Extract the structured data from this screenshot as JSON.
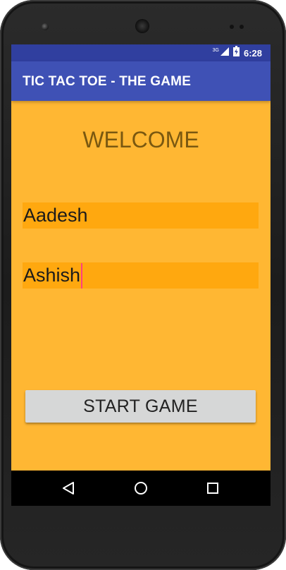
{
  "status_bar": {
    "network_label": "3G",
    "time": "6:28"
  },
  "app_bar": {
    "title": "TIC TAC TOE - THE GAME"
  },
  "main": {
    "welcome": "WELCOME",
    "player1_name": "Aadesh",
    "player2_name": "Ashish",
    "start_button_label": "START GAME"
  },
  "nav_bar": {
    "icons": [
      "back-icon",
      "home-icon",
      "recents-icon"
    ]
  },
  "colors": {
    "status_bar": "#303f9f",
    "app_bar": "#3f51b5",
    "background": "#ffb733",
    "input_field": "#ffa80f",
    "cursor": "#ff4081",
    "button": "#d6d7d7"
  }
}
